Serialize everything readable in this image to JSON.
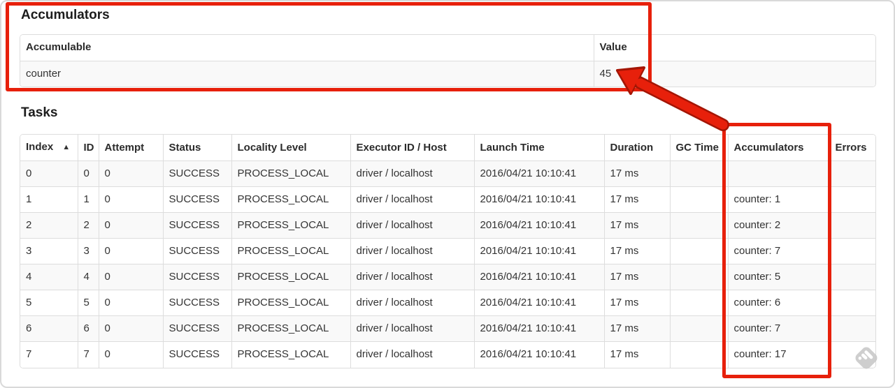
{
  "accumulators_section": {
    "heading": "Accumulators",
    "table": {
      "headers": [
        "Accumulable",
        "Value"
      ],
      "rows": [
        [
          "counter",
          "45"
        ]
      ]
    }
  },
  "tasks_section": {
    "heading": "Tasks",
    "table": {
      "sort_icon": "▲",
      "headers": [
        "Index",
        "ID",
        "Attempt",
        "Status",
        "Locality Level",
        "Executor ID / Host",
        "Launch Time",
        "Duration",
        "GC Time",
        "Accumulators",
        "Errors"
      ],
      "rows": [
        [
          "0",
          "0",
          "0",
          "SUCCESS",
          "PROCESS_LOCAL",
          "driver / localhost",
          "2016/04/21 10:10:41",
          "17 ms",
          "",
          "",
          ""
        ],
        [
          "1",
          "1",
          "0",
          "SUCCESS",
          "PROCESS_LOCAL",
          "driver / localhost",
          "2016/04/21 10:10:41",
          "17 ms",
          "",
          "counter: 1",
          ""
        ],
        [
          "2",
          "2",
          "0",
          "SUCCESS",
          "PROCESS_LOCAL",
          "driver / localhost",
          "2016/04/21 10:10:41",
          "17 ms",
          "",
          "counter: 2",
          ""
        ],
        [
          "3",
          "3",
          "0",
          "SUCCESS",
          "PROCESS_LOCAL",
          "driver / localhost",
          "2016/04/21 10:10:41",
          "17 ms",
          "",
          "counter: 7",
          ""
        ],
        [
          "4",
          "4",
          "0",
          "SUCCESS",
          "PROCESS_LOCAL",
          "driver / localhost",
          "2016/04/21 10:10:41",
          "17 ms",
          "",
          "counter: 5",
          ""
        ],
        [
          "5",
          "5",
          "0",
          "SUCCESS",
          "PROCESS_LOCAL",
          "driver / localhost",
          "2016/04/21 10:10:41",
          "17 ms",
          "",
          "counter: 6",
          ""
        ],
        [
          "6",
          "6",
          "0",
          "SUCCESS",
          "PROCESS_LOCAL",
          "driver / localhost",
          "2016/04/21 10:10:41",
          "17 ms",
          "",
          "counter: 7",
          ""
        ],
        [
          "7",
          "7",
          "0",
          "SUCCESS",
          "PROCESS_LOCAL",
          "driver / localhost",
          "2016/04/21 10:10:41",
          "17 ms",
          "",
          "counter: 17",
          ""
        ]
      ]
    }
  },
  "colors": {
    "annotation_red": "#e7200b",
    "annotation_red_dark": "#a41504",
    "watermark_gray": "#c9c9c9",
    "table_border": "#dddddd",
    "stripe_bg": "#f9f9f9"
  }
}
